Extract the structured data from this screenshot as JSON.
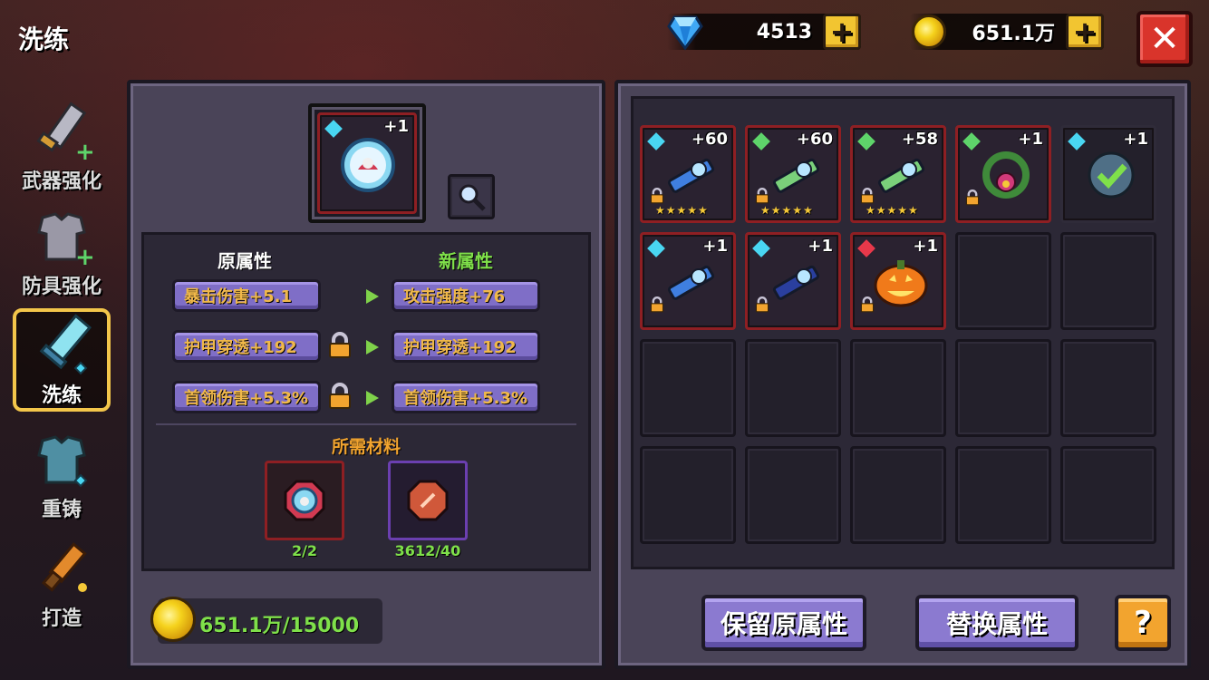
{
  "header": {
    "title": "洗练",
    "diamonds": "4513",
    "gold": "651.1万",
    "close_glyph": "✕"
  },
  "sidebar": {
    "items": [
      {
        "label": "武器强化",
        "icon": "sword-upgrade-icon"
      },
      {
        "label": "防具强化",
        "icon": "armor-upgrade-icon"
      },
      {
        "label": "洗练",
        "icon": "refine-sword-icon",
        "active": true
      },
      {
        "label": "重铸",
        "icon": "recast-armor-icon"
      },
      {
        "label": "打造",
        "icon": "forge-hammer-icon"
      }
    ]
  },
  "refine": {
    "item_level": "+1",
    "old_header": "原属性",
    "new_header": "新属性",
    "rows": [
      {
        "old": "暴击伤害+5.1",
        "new": "攻击强度+76",
        "locked": false
      },
      {
        "old": "护甲穿透+192",
        "new": "护甲穿透+192",
        "locked": true
      },
      {
        "old": "首领伤害+5.3%",
        "new": "首领伤害+5.3%",
        "locked": true
      }
    ],
    "materials_header": "所需材料",
    "materials": [
      {
        "count": "2/2",
        "icon": "orb-material-icon"
      },
      {
        "count": "3612/40",
        "icon": "red-gem-material-icon"
      }
    ],
    "gold_cost": "651.1万/15000"
  },
  "inventory": {
    "items": [
      {
        "level": "+60",
        "stars": "★★★★★",
        "gem": "#49d6f2",
        "name": "blue-crossbow-icon"
      },
      {
        "level": "+60",
        "stars": "★★★★★",
        "gem": "#5ed46a",
        "name": "syringe-gun-icon"
      },
      {
        "level": "+58",
        "stars": "★★★★★",
        "gem": "#5ed46a",
        "name": "green-bow-icon"
      },
      {
        "level": "+1",
        "stars": "",
        "gem": "#5ed46a",
        "name": "flower-wreath-icon"
      },
      {
        "level": "+1",
        "stars": "",
        "gem": "#49d6f2",
        "name": "check-orb-icon"
      },
      {
        "level": "+1",
        "stars": "",
        "gem": "#49d6f2",
        "name": "shark-gun-icon"
      },
      {
        "level": "+1",
        "stars": "",
        "gem": "#49d6f2",
        "name": "dark-claw-icon"
      },
      {
        "level": "+1",
        "stars": "",
        "gem": "#e8384a",
        "name": "pumpkin-icon"
      }
    ],
    "empty_slots": 12
  },
  "buttons": {
    "keep": "保留原属性",
    "replace": "替换属性",
    "help": "?"
  }
}
